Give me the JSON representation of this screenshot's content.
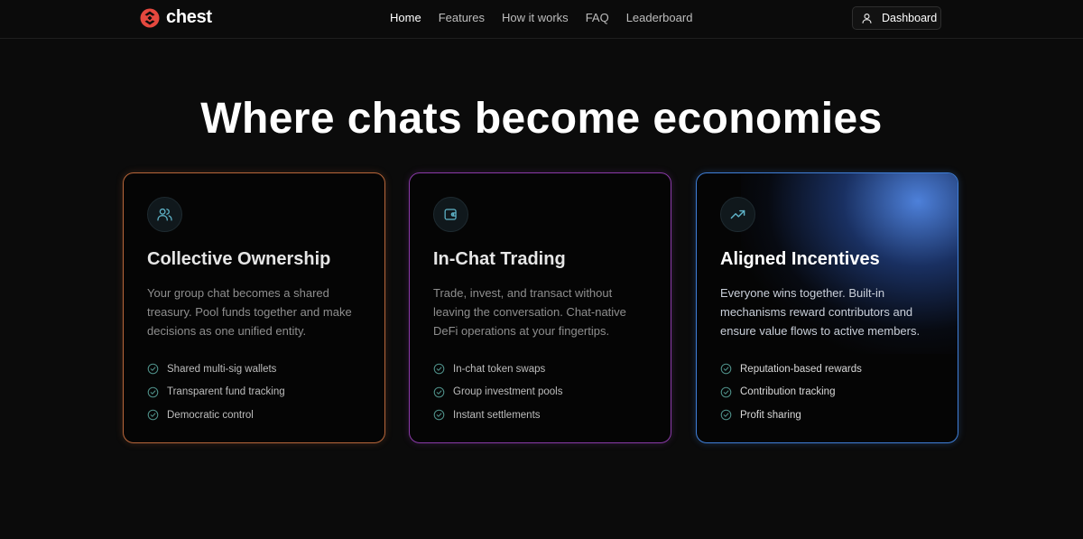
{
  "brand": {
    "name": "chest"
  },
  "nav": {
    "links": [
      {
        "label": "Home",
        "active": true
      },
      {
        "label": "Features"
      },
      {
        "label": "How it works"
      },
      {
        "label": "FAQ"
      },
      {
        "label": "Leaderboard"
      }
    ],
    "dashboard_label": "Dashboard"
  },
  "hero": {
    "title": "Where chats become economies"
  },
  "cards": [
    {
      "icon": "users-icon",
      "title": "Collective Ownership",
      "description": "Your group chat becomes a shared treasury. Pool funds together and make decisions as one unified entity.",
      "features": [
        "Shared multi-sig wallets",
        "Transparent fund tracking",
        "Democratic control"
      ],
      "accent": "#b8663a"
    },
    {
      "icon": "wallet-icon",
      "title": "In-Chat Trading",
      "description": "Trade, invest, and transact without leaving the conversation. Chat-native DeFi operations at your fingertips.",
      "features": [
        "In-chat token swaps",
        "Group investment pools",
        "Instant settlements"
      ],
      "accent": "#8a3aa8"
    },
    {
      "icon": "trending-up-icon",
      "title": "Aligned Incentives",
      "description": "Everyone wins together. Built-in mechanisms reward contributors and ensure value flows to active members.",
      "features": [
        "Reputation-based rewards",
        "Contribution tracking",
        "Profit sharing"
      ],
      "accent": "#3f7fd8"
    }
  ],
  "colors": {
    "background": "#0b0b0b",
    "icon_teal": "#5fb4c9",
    "check": "#4e8f88",
    "logo_red": "#e5483e"
  }
}
